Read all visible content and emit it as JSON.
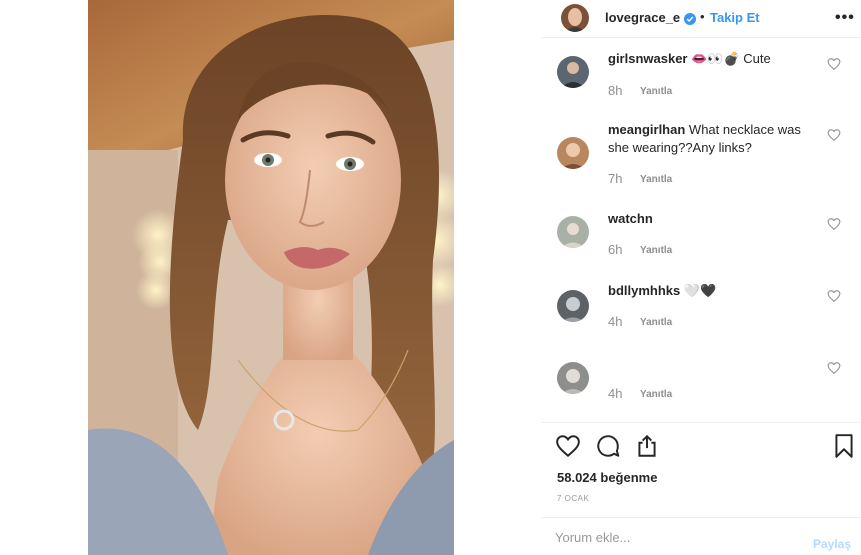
{
  "post": {
    "username": "lovegrace_e",
    "separator": "•",
    "follow_label": "Takip Et",
    "more_label": "•••"
  },
  "comments": [
    {
      "username": "girlsnwasker",
      "text": "👄👀💣 Cute",
      "time": "8h",
      "reply_label": "Yanıtla"
    },
    {
      "username": "meangirlhan",
      "text": "What necklace was she wearing??Any links?",
      "time": "7h",
      "reply_label": "Yanıtla"
    },
    {
      "username": "watchn",
      "text": "",
      "time": "6h",
      "reply_label": "Yanıtla"
    },
    {
      "username": "bdllymhhks",
      "text": "🤍🖤",
      "time": "4h",
      "reply_label": "Yanıtla"
    },
    {
      "username": "",
      "text": "",
      "time": "4h",
      "reply_label": "Yanıtla"
    }
  ],
  "actions": {
    "likes": "58.024 beğenme",
    "date": "7 OCAK"
  },
  "add_comment": {
    "placeholder": "Yorum ekle...",
    "share_label": "Paylaş"
  },
  "colors": {
    "link": "#3897f0",
    "muted": "#8e8e8e",
    "share_disabled": "#b3dbff"
  },
  "icons": [
    "verified-badge-icon",
    "more-options-icon",
    "heart-icon",
    "comment-icon",
    "share-icon",
    "bookmark-icon"
  ]
}
